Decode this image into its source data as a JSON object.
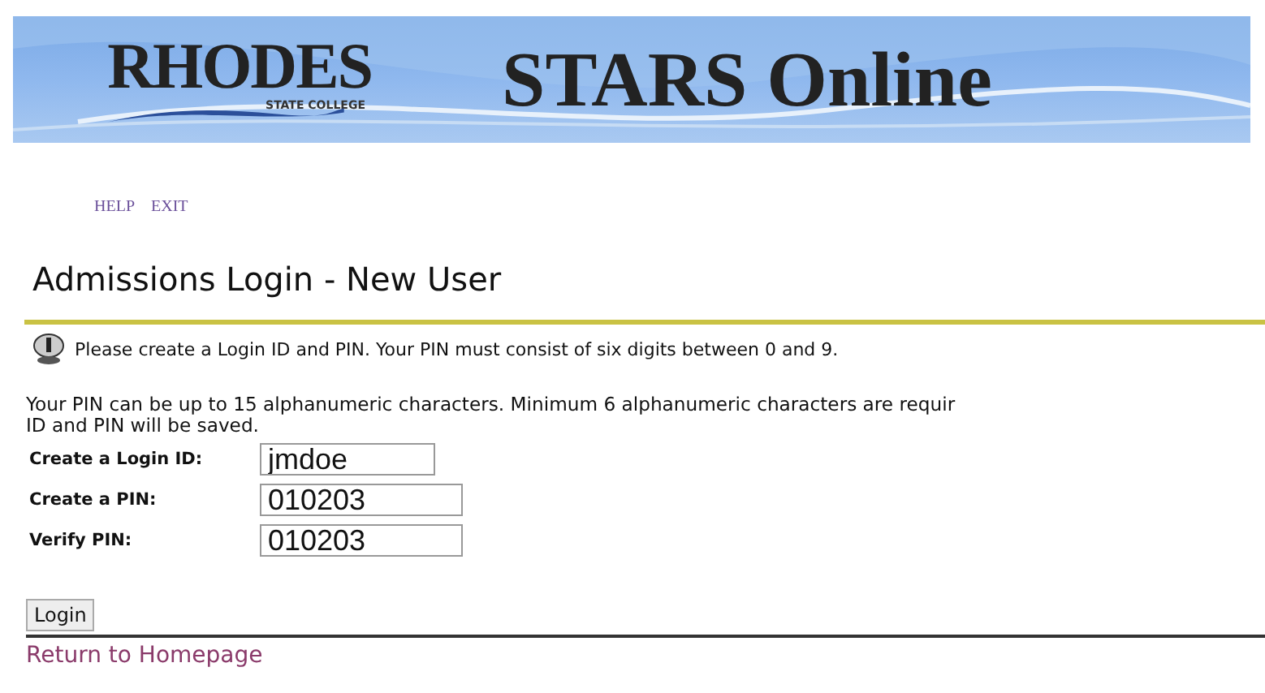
{
  "banner": {
    "logo": "RHODES",
    "logo_subtitle": "STATE COLLEGE",
    "title": "STARS Online"
  },
  "nav_links": [
    "HELP",
    "EXIT"
  ],
  "page_title": "Admissions Login - New User",
  "info_message": "Please create a Login ID and PIN. Your PIN must consist of six digits between 0 and 9.",
  "notes": [
    "Your PIN can be up to 15 alphanumeric characters. Minimum 6 alphanumeric characters are requir",
    "ID and PIN will be saved."
  ],
  "fields": [
    {
      "label": "Create a Login ID:",
      "value": "jmdoe",
      "kind": "short"
    },
    {
      "label": "Create a PIN:",
      "value": "010203",
      "kind": "long"
    },
    {
      "label": "Verify PIN:",
      "value": "010203",
      "kind": "long"
    }
  ],
  "login_button": "Login",
  "return_link": "Return to Homepage"
}
